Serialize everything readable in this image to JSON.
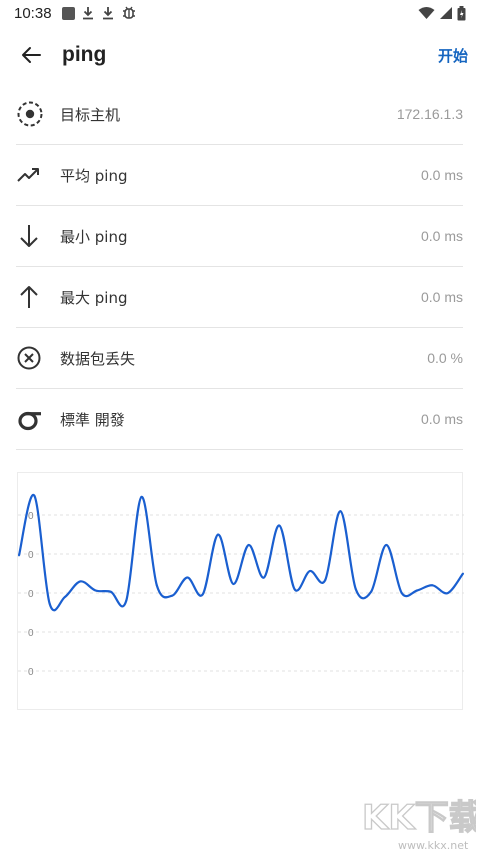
{
  "status_bar": {
    "time": "10:38"
  },
  "app_bar": {
    "title": "ping",
    "action_label": "开始"
  },
  "rows": [
    {
      "label": "目标主机",
      "value": "172.16.1.3",
      "icon": "target-icon"
    },
    {
      "label": "平均 ping",
      "value": "0.0 ms",
      "icon": "trending-up-icon"
    },
    {
      "label": "最小 ping",
      "value": "0.0 ms",
      "icon": "arrow-down-icon"
    },
    {
      "label": "最大 ping",
      "value": "0.0 ms",
      "icon": "arrow-up-icon"
    },
    {
      "label": "数据包丢失",
      "value": "0.0 %",
      "icon": "cancel-circle-icon"
    },
    {
      "label": "標準 開發",
      "value": "0.0 ms",
      "icon": "sigma-icon"
    }
  ],
  "chart_data": {
    "type": "line",
    "y_tick_labels": [
      "0",
      "0",
      "0",
      "0",
      "0"
    ],
    "grid": true,
    "line_color": "#1a5fd0",
    "series": [
      {
        "values": [
          0.52,
          0.98,
          0.15,
          0.2,
          0.32,
          0.25,
          0.24,
          0.17,
          0.97,
          0.29,
          0.21,
          0.35,
          0.22,
          0.68,
          0.3,
          0.6,
          0.35,
          0.75,
          0.26,
          0.4,
          0.33,
          0.86,
          0.26,
          0.24,
          0.6,
          0.23,
          0.25,
          0.29,
          0.23,
          0.38
        ]
      }
    ]
  },
  "watermark": {
    "text": "KK下载",
    "url": "www.kkx.net"
  }
}
